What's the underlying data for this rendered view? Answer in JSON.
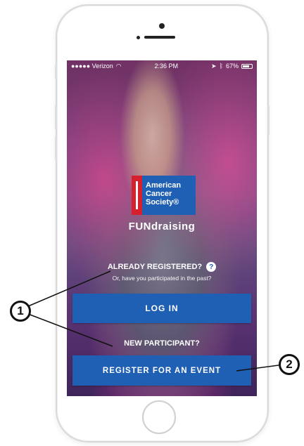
{
  "status_bar": {
    "carrier": "●●●●● Verizon",
    "time": "2:36 PM",
    "battery_text": "67%"
  },
  "logo": {
    "line1": "American",
    "line2": "Cancer",
    "line3": "Society®"
  },
  "brand": {
    "title": "FUNdraising"
  },
  "login_section": {
    "question": "ALREADY REGISTERED?",
    "help_symbol": "?",
    "subtext": "Or, have you participated in the past?",
    "login_label": "LOG IN"
  },
  "register_section": {
    "question": "NEW PARTICIPANT?",
    "register_label": "REGISTER FOR AN EVENT"
  },
  "callouts": {
    "one": "1",
    "two": "2"
  },
  "colors": {
    "button_blue": "#1f5fb4",
    "logo_red": "#d6202e",
    "callout_stroke": "#111111"
  }
}
